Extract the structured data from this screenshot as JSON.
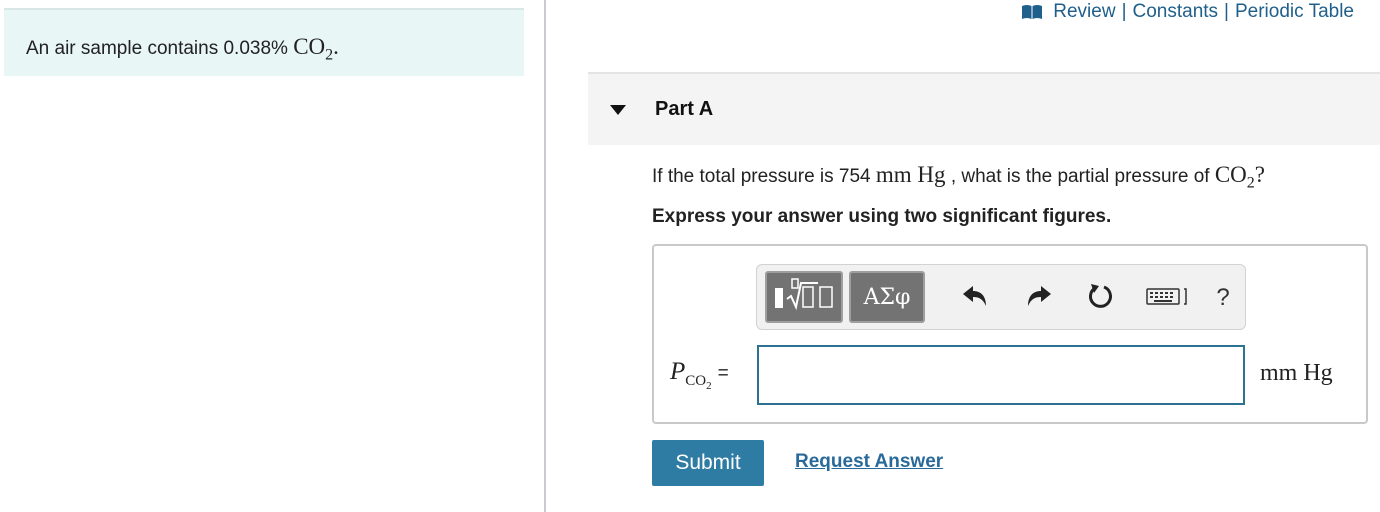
{
  "intro": {
    "text_before": "An air sample contains 0.038% ",
    "chem_main": "CO",
    "chem_sub": "2",
    "text_after": "."
  },
  "top_links": {
    "review": "Review",
    "sep": "|",
    "constants": "Constants",
    "periodic_table": "Periodic Table",
    "icon": "book-icon"
  },
  "part": {
    "title": "Part A",
    "question_start": "If the total pressure is 754 ",
    "question_unit": "mm Hg",
    "question_mid": " , what is the partial pressure of ",
    "question_chem_main": "CO",
    "question_chem_sub": "2",
    "question_end": "?",
    "instruction": "Express your answer using two significant figures."
  },
  "toolbar": {
    "greek_label": "ΑΣφ",
    "icons": [
      "templates-icon",
      "greek-letters-icon",
      "undo-icon",
      "redo-icon",
      "reset-icon",
      "keyboard-icon",
      "help-icon"
    ],
    "help_label": "?"
  },
  "answer": {
    "var_main": "P",
    "var_sub_main": "CO",
    "var_sub_sub": "2",
    "equals": "=",
    "value": "",
    "unit": "mm Hg"
  },
  "actions": {
    "submit": "Submit",
    "request_answer": "Request Answer"
  },
  "colors": {
    "accent": "#2e7ba4",
    "link": "#1f5f8b",
    "intro_bg": "#e8f6f6",
    "input_border": "#2e7191"
  }
}
